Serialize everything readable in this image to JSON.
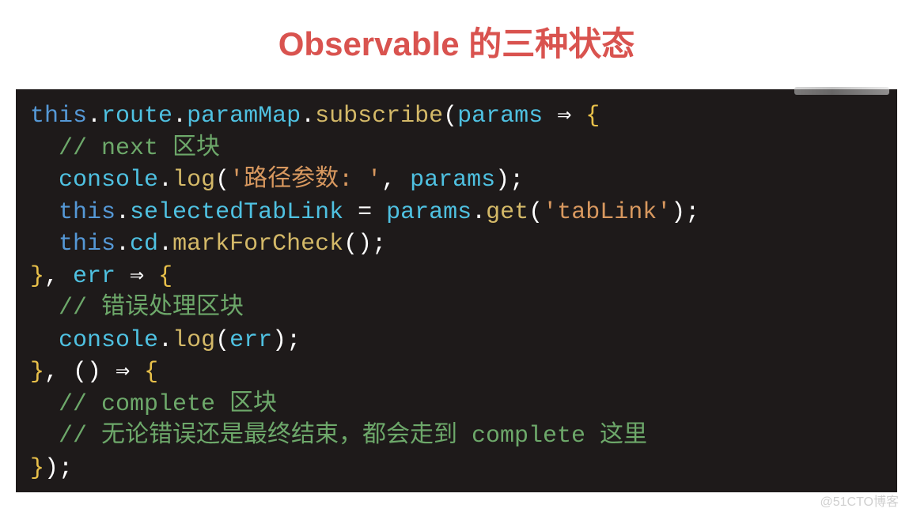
{
  "title": "Observable 的三种状态",
  "watermark": "@51CTO博客",
  "code": {
    "l1": {
      "this": "this",
      "dot1": ".",
      "route": "route",
      "dot2": ".",
      "paramMap": "paramMap",
      "dot3": ".",
      "subscribe": "subscribe",
      "open": "(",
      "params": "params",
      "arrow": " ⇒ ",
      "brace": "{"
    },
    "l2": {
      "indent": "  ",
      "comment": "// next 区块"
    },
    "l3": {
      "indent": "  ",
      "console": "console",
      "dot": ".",
      "log": "log",
      "open": "(",
      "str": "'路径参数: '",
      "comma": ", ",
      "params": "params",
      "close": ")",
      "semi": ";"
    },
    "l4": {
      "indent": "  ",
      "this": "this",
      "dot1": ".",
      "selectedTabLink": "selectedTabLink",
      "eq": " = ",
      "params": "params",
      "dot2": ".",
      "get": "get",
      "open": "(",
      "str": "'tabLink'",
      "close": ")",
      "semi": ";"
    },
    "l5": {
      "indent": "  ",
      "this": "this",
      "dot1": ".",
      "cd": "cd",
      "dot2": ".",
      "markForCheck": "markForCheck",
      "open": "(",
      "close": ")",
      "semi": ";"
    },
    "l6": {
      "brace": "}",
      "comma": ", ",
      "err": "err",
      "arrow": " ⇒ ",
      "brace2": "{"
    },
    "l7": {
      "indent": "  ",
      "comment": "// 错误处理区块"
    },
    "l8": {
      "indent": "  ",
      "console": "console",
      "dot": ".",
      "log": "log",
      "open": "(",
      "err": "err",
      "close": ")",
      "semi": ";"
    },
    "l9": {
      "brace": "}",
      "comma": ", ",
      "open": "(",
      "close": ")",
      "arrow": " ⇒ ",
      "brace2": "{"
    },
    "l10": {
      "indent": "  ",
      "comment": "// complete 区块"
    },
    "l11": {
      "indent": "  ",
      "comment": "// 无论错误还是最终结束，都会走到 complete 这里"
    },
    "l12": {
      "brace": "}",
      "close": ")",
      "semi": ";"
    }
  }
}
